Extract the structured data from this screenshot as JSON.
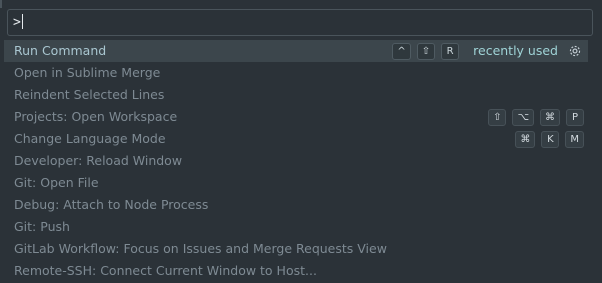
{
  "input": {
    "value": ">"
  },
  "commands": [
    {
      "label": "Run Command",
      "keys": [
        "^",
        "⇧",
        "R"
      ],
      "note": "recently used",
      "selected": true
    },
    {
      "label": "Open in Sublime Merge",
      "keys": []
    },
    {
      "label": "Reindent Selected Lines",
      "keys": []
    },
    {
      "label": "Projects: Open Workspace",
      "keys": [
        "⇧",
        "⌥",
        "⌘",
        "P"
      ]
    },
    {
      "label": "Change Language Mode",
      "keys": [
        "⌘",
        "K",
        "M"
      ]
    },
    {
      "label": "Developer: Reload Window",
      "keys": []
    },
    {
      "label": "Git: Open File",
      "keys": []
    },
    {
      "label": "Debug: Attach to Node Process",
      "keys": []
    },
    {
      "label": "Git: Push",
      "keys": []
    },
    {
      "label": "GitLab Workflow: Focus on Issues and Merge Requests View",
      "keys": []
    },
    {
      "label": "Remote-SSH: Connect Current Window to Host...",
      "keys": []
    }
  ],
  "icons": {
    "settings": "gear-icon"
  },
  "colors": {
    "background": "#2b3238",
    "selected": "#3c464c",
    "accent": "#9fd3d6"
  }
}
